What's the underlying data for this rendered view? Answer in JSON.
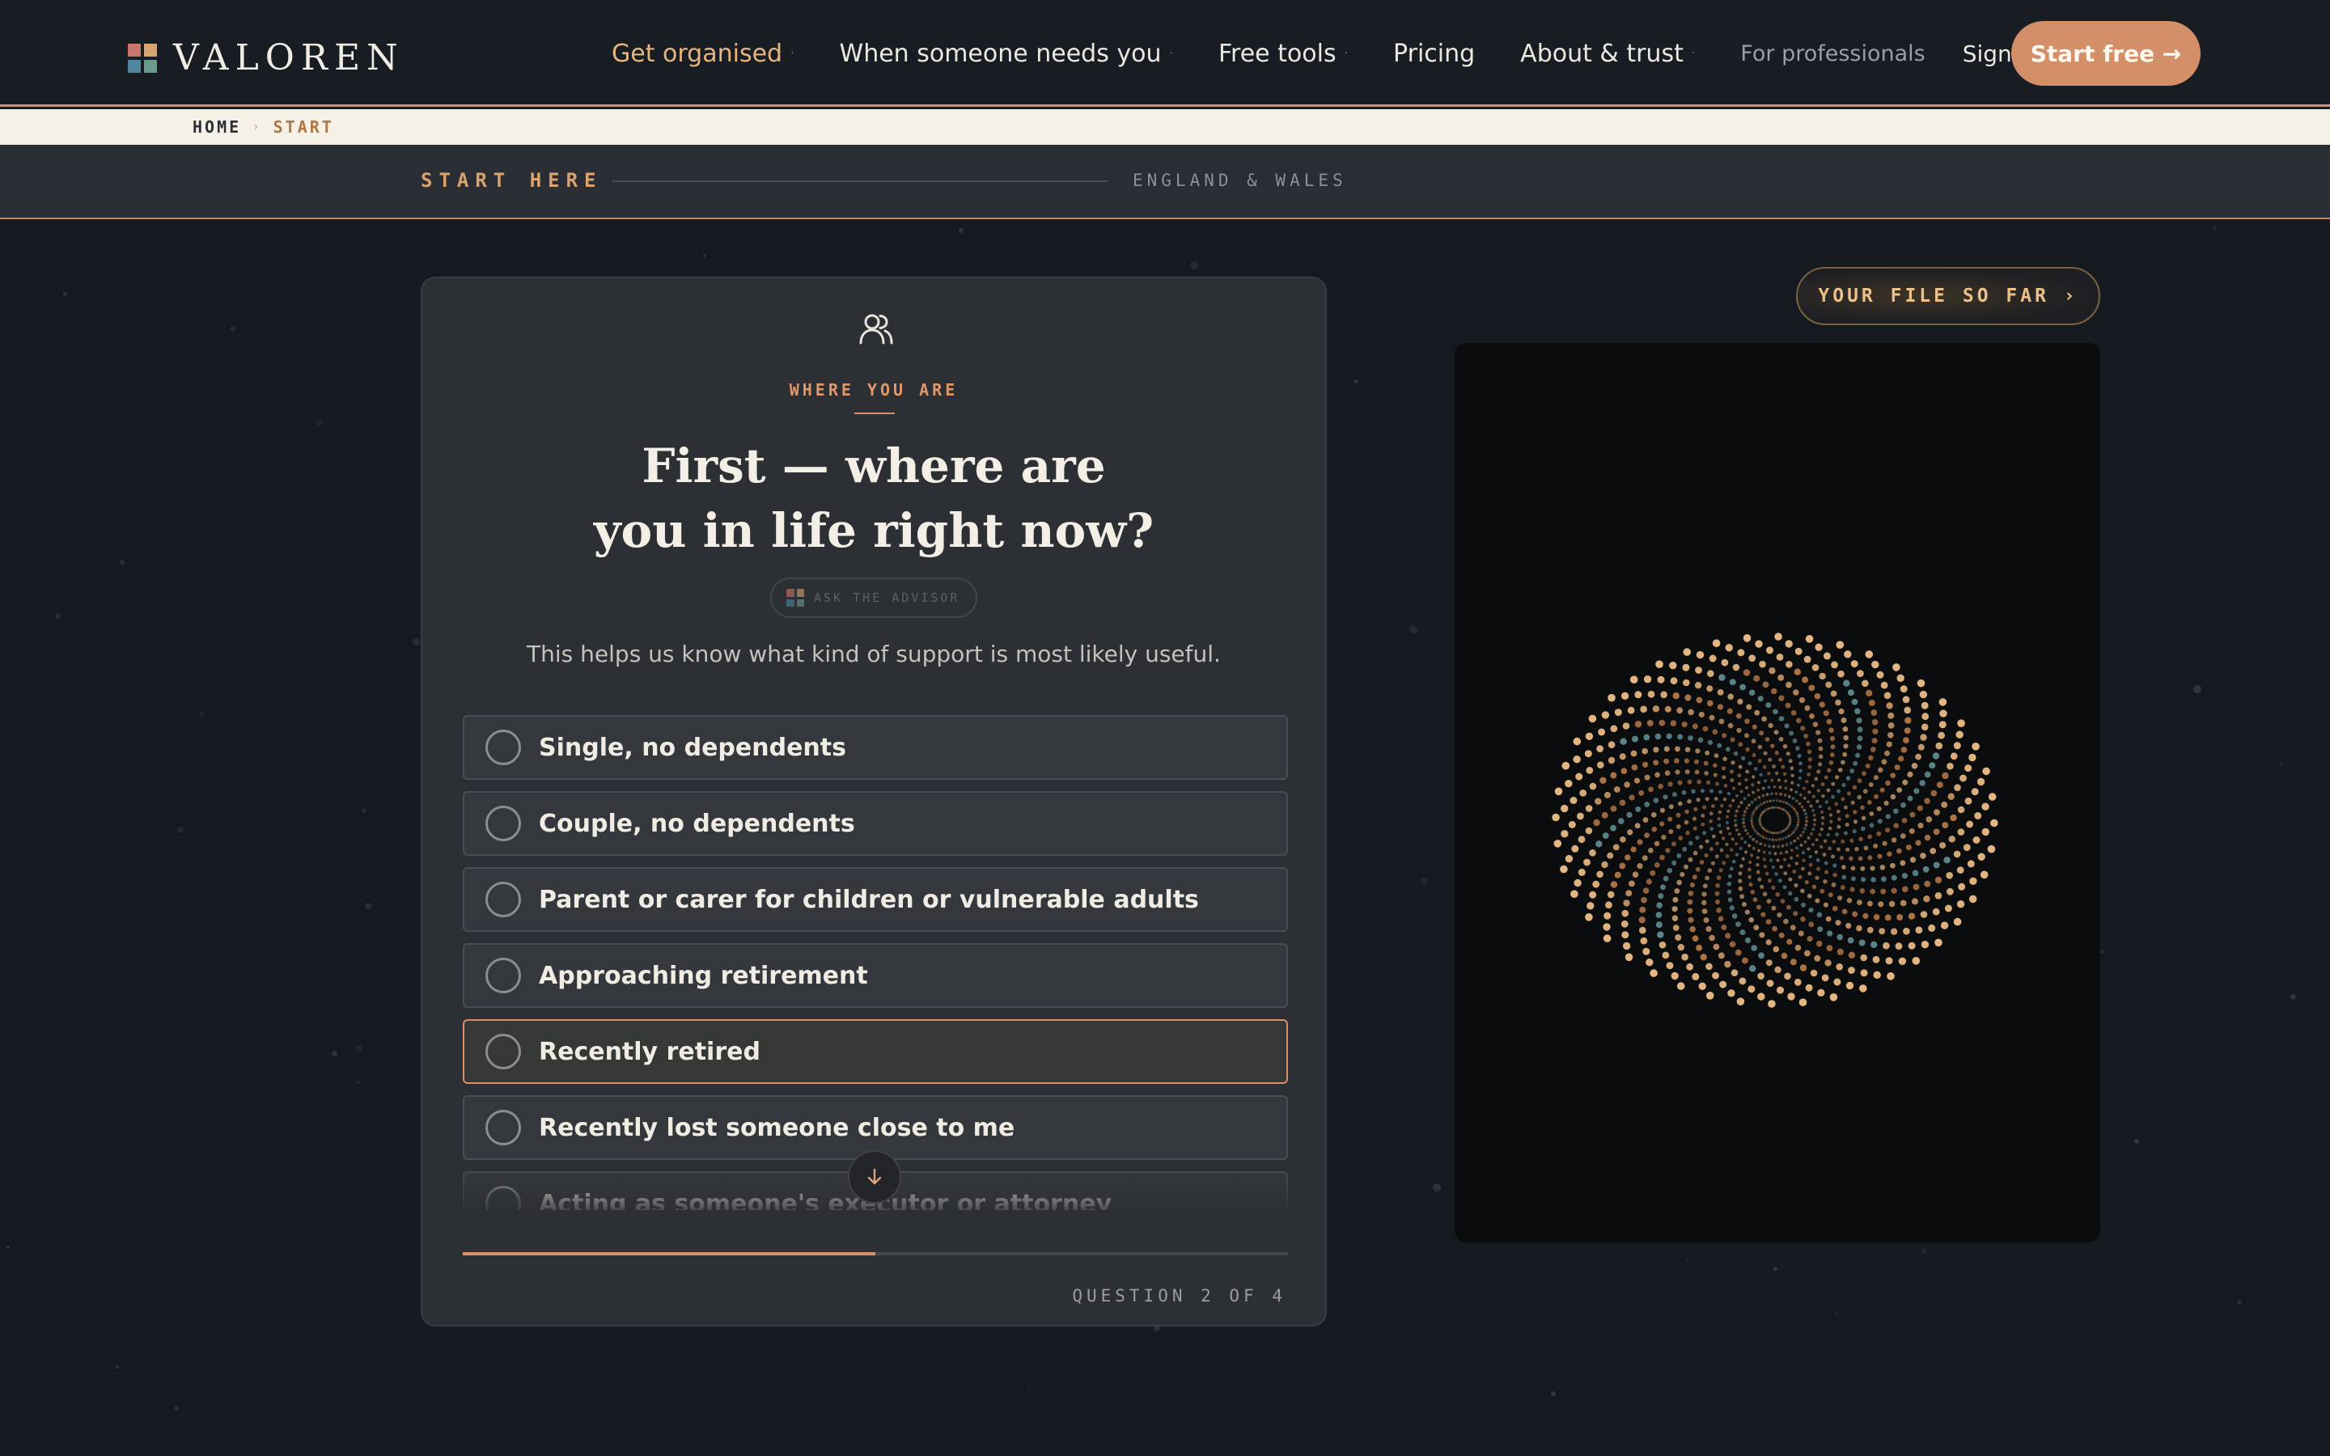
{
  "brand": {
    "name": "VALOREN",
    "mark_colors": [
      "#c9766a",
      "#d9a46e",
      "#4f86a0",
      "#6a9a8c"
    ]
  },
  "nav": {
    "links": [
      {
        "label": "Get organised",
        "has_menu": true,
        "active": true
      },
      {
        "label": "When someone needs you",
        "has_menu": true,
        "active": false
      },
      {
        "label": "Free tools",
        "has_menu": true,
        "active": false
      },
      {
        "label": "Pricing",
        "has_menu": false,
        "active": false
      },
      {
        "label": "About & trust",
        "has_menu": true,
        "active": false
      }
    ],
    "professionals": "For professionals",
    "sign_in": "Sign in",
    "cta": "Start free →",
    "menu_marker": "·"
  },
  "breadcrumb": {
    "home": "HOME",
    "separator": "›",
    "current": "START"
  },
  "band": {
    "title": "START HERE",
    "region": "ENGLAND & WALES"
  },
  "question": {
    "icon": "people-icon",
    "eyebrow": "WHERE YOU ARE",
    "title_line1": "First — where are",
    "title_line2": "you in life right now?",
    "advisor_label": "ASK THE ADVISOR",
    "subtitle": "This helps us know what kind of support is most likely useful.",
    "options": [
      {
        "label": "Single, no dependents",
        "selected": false
      },
      {
        "label": "Couple, no dependents",
        "selected": false
      },
      {
        "label": "Parent or carer for children or vulnerable adults",
        "selected": false
      },
      {
        "label": "Approaching retirement",
        "selected": false
      },
      {
        "label": "Recently retired",
        "selected": true
      },
      {
        "label": "Recently lost someone close to me",
        "selected": false
      },
      {
        "label": "Acting as someone's executor or attorney",
        "selected": false
      }
    ],
    "progress": 0.5,
    "counter": "QUESTION 2 OF 4"
  },
  "side": {
    "file_button": "YOUR FILE SO FAR ›"
  },
  "colors": {
    "accent": "#d8906a",
    "accent_light": "#e8b57e",
    "background": "#151920",
    "card": "#2c2f34"
  }
}
